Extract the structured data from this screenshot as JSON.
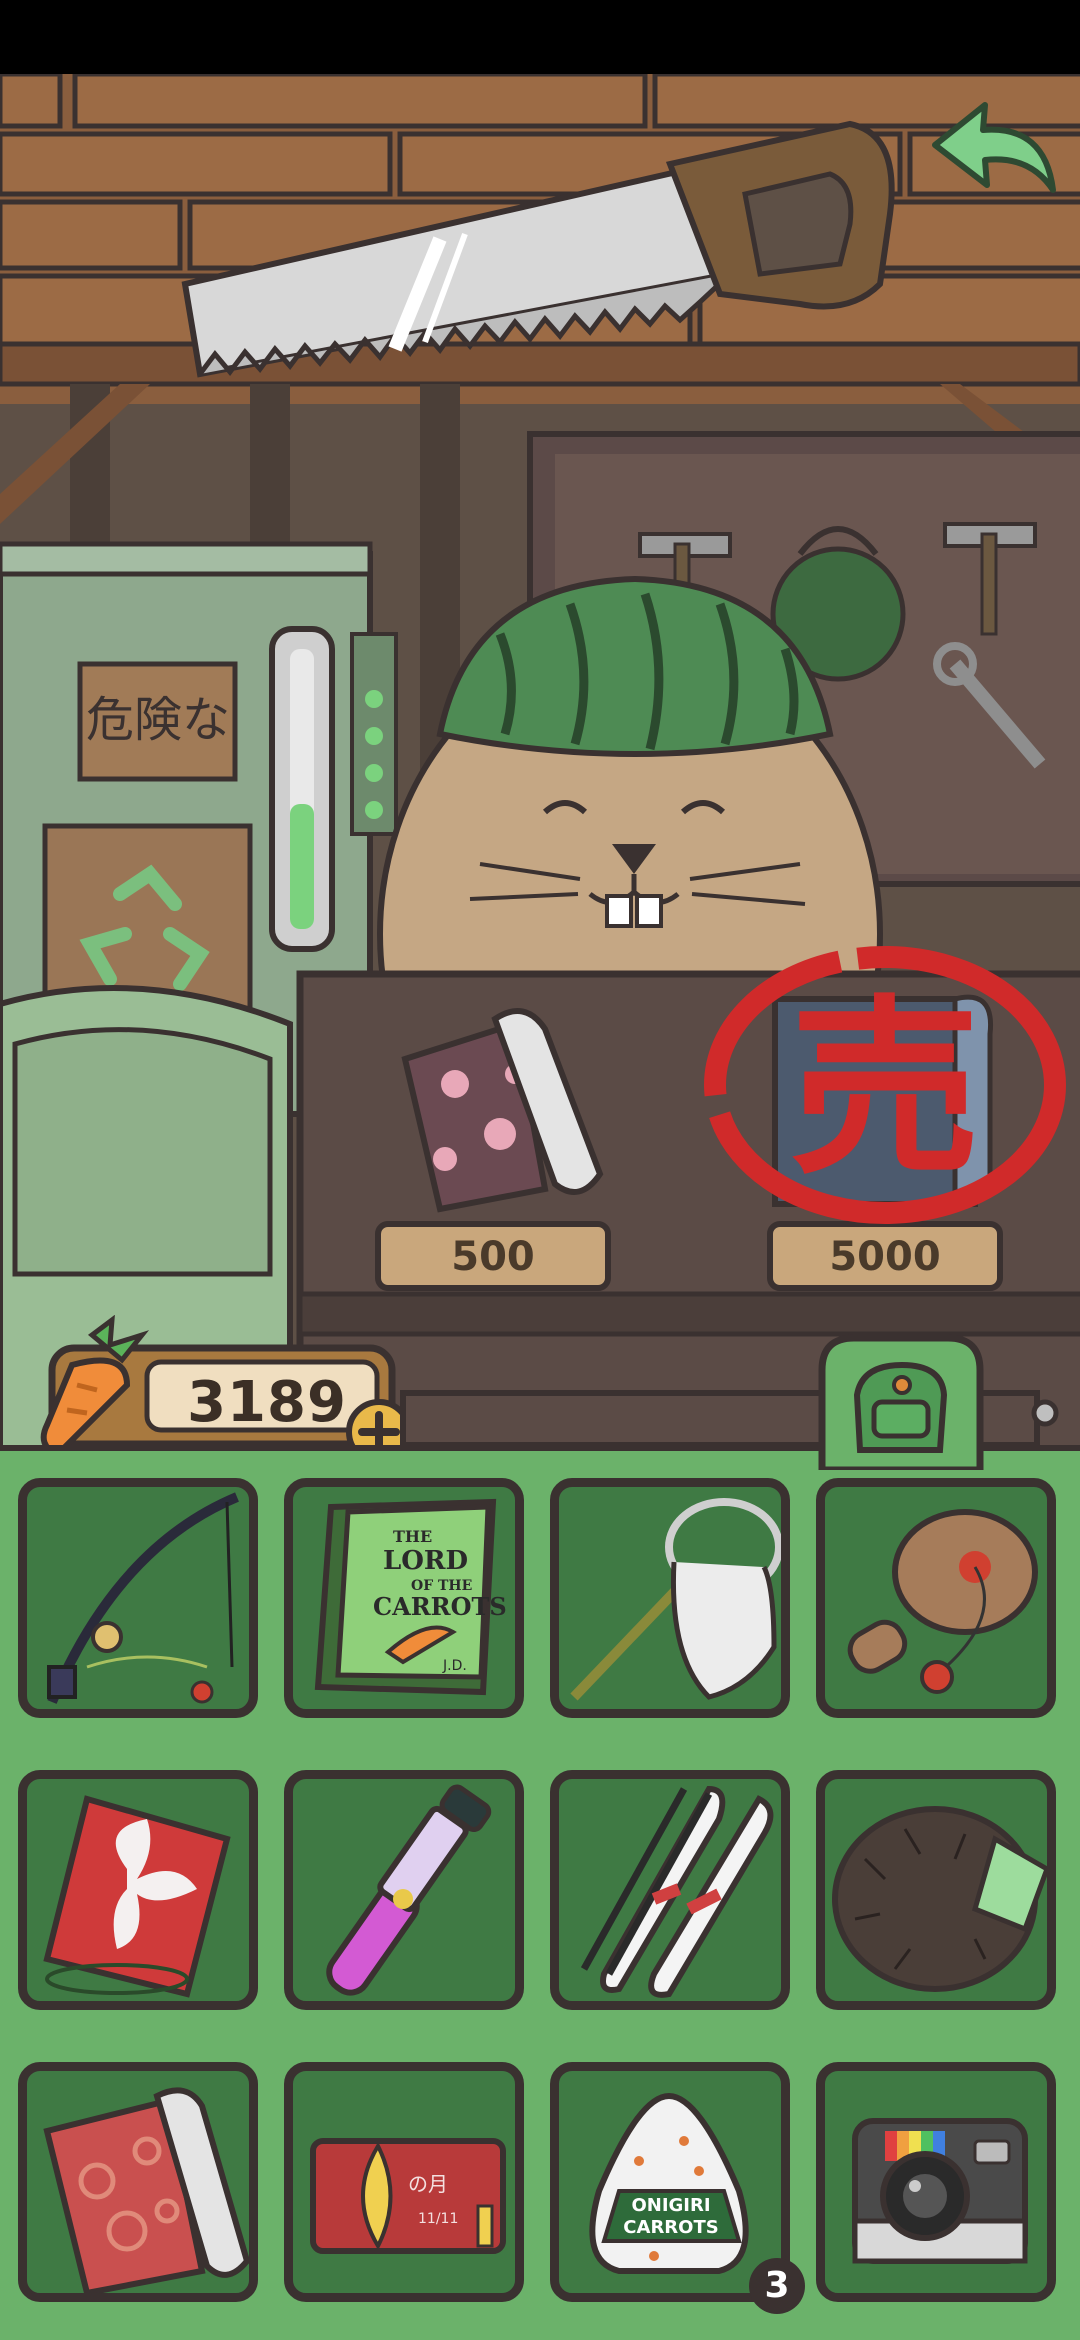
{
  "shop": {
    "items": [
      {
        "name": "sakura-fabric-roll",
        "price": "500",
        "sold": false
      },
      {
        "name": "blue-fabric-roll",
        "price": "5000",
        "sold": true,
        "stamp_text": "売"
      }
    ]
  },
  "wall_sign": {
    "text": "危険な"
  },
  "currency": {
    "icon": "carrot-icon",
    "amount": "3189"
  },
  "inventory": {
    "tab_icon": "backpack-icon",
    "items": [
      {
        "name": "fishing-rod"
      },
      {
        "name": "lord-of-the-carrots-book",
        "title_lines": [
          "THE",
          "LORD",
          "OF THE",
          "CARROTS"
        ],
        "author": "J.D."
      },
      {
        "name": "bug-net"
      },
      {
        "name": "paddle-ball-toy"
      },
      {
        "name": "red-kite"
      },
      {
        "name": "potion-vial"
      },
      {
        "name": "ski-set"
      },
      {
        "name": "fur-hat"
      },
      {
        "name": "red-fabric-roll"
      },
      {
        "name": "moon-card",
        "text": "の月",
        "date": "11/11"
      },
      {
        "name": "onigiri",
        "label_lines": [
          "ONIGIRI",
          "CARROTS"
        ],
        "count": "3"
      },
      {
        "name": "instant-camera"
      }
    ]
  },
  "colors": {
    "panel_green": "#6bb26a",
    "slot_green": "#3f7a44",
    "outline": "#3a3130",
    "stamp_red": "#d02a2a",
    "back_arrow": "#7fcf8a"
  }
}
